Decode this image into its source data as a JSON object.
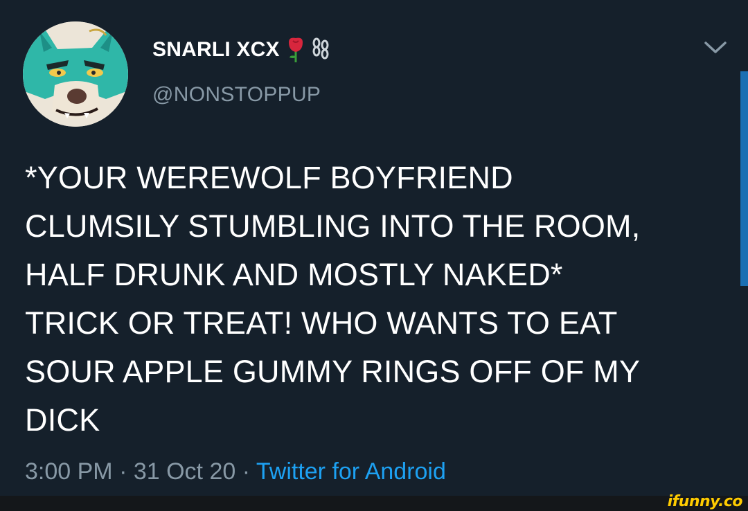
{
  "author": {
    "display_name": "SNARLI XCX",
    "handle": "@NONSTOPPUP",
    "name_emojis": [
      "rose-emoji",
      "chain-emoji"
    ]
  },
  "tweet": {
    "text": "*YOUR WEREWOLF BOYFRIEND\nCLUMSILY STUMBLING INTO THE ROOM,\nHALF DRUNK AND MOSTLY NAKED*\nTRICK OR TREAT! WHO WANTS TO EAT\nSOUR APPLE GUMMY RINGS OFF OF MY\nDICK",
    "time": "3:00 PM",
    "date": "31 Oct 20",
    "separator": " · ",
    "source": "Twitter for Android"
  },
  "icons": {
    "more_menu": "chevron-down-icon"
  },
  "watermark": {
    "text": "ifunny.co"
  },
  "colors": {
    "background": "#15202b",
    "secondary_text": "#8899a6",
    "link": "#1da1f2",
    "watermark": "#ffcc00"
  }
}
